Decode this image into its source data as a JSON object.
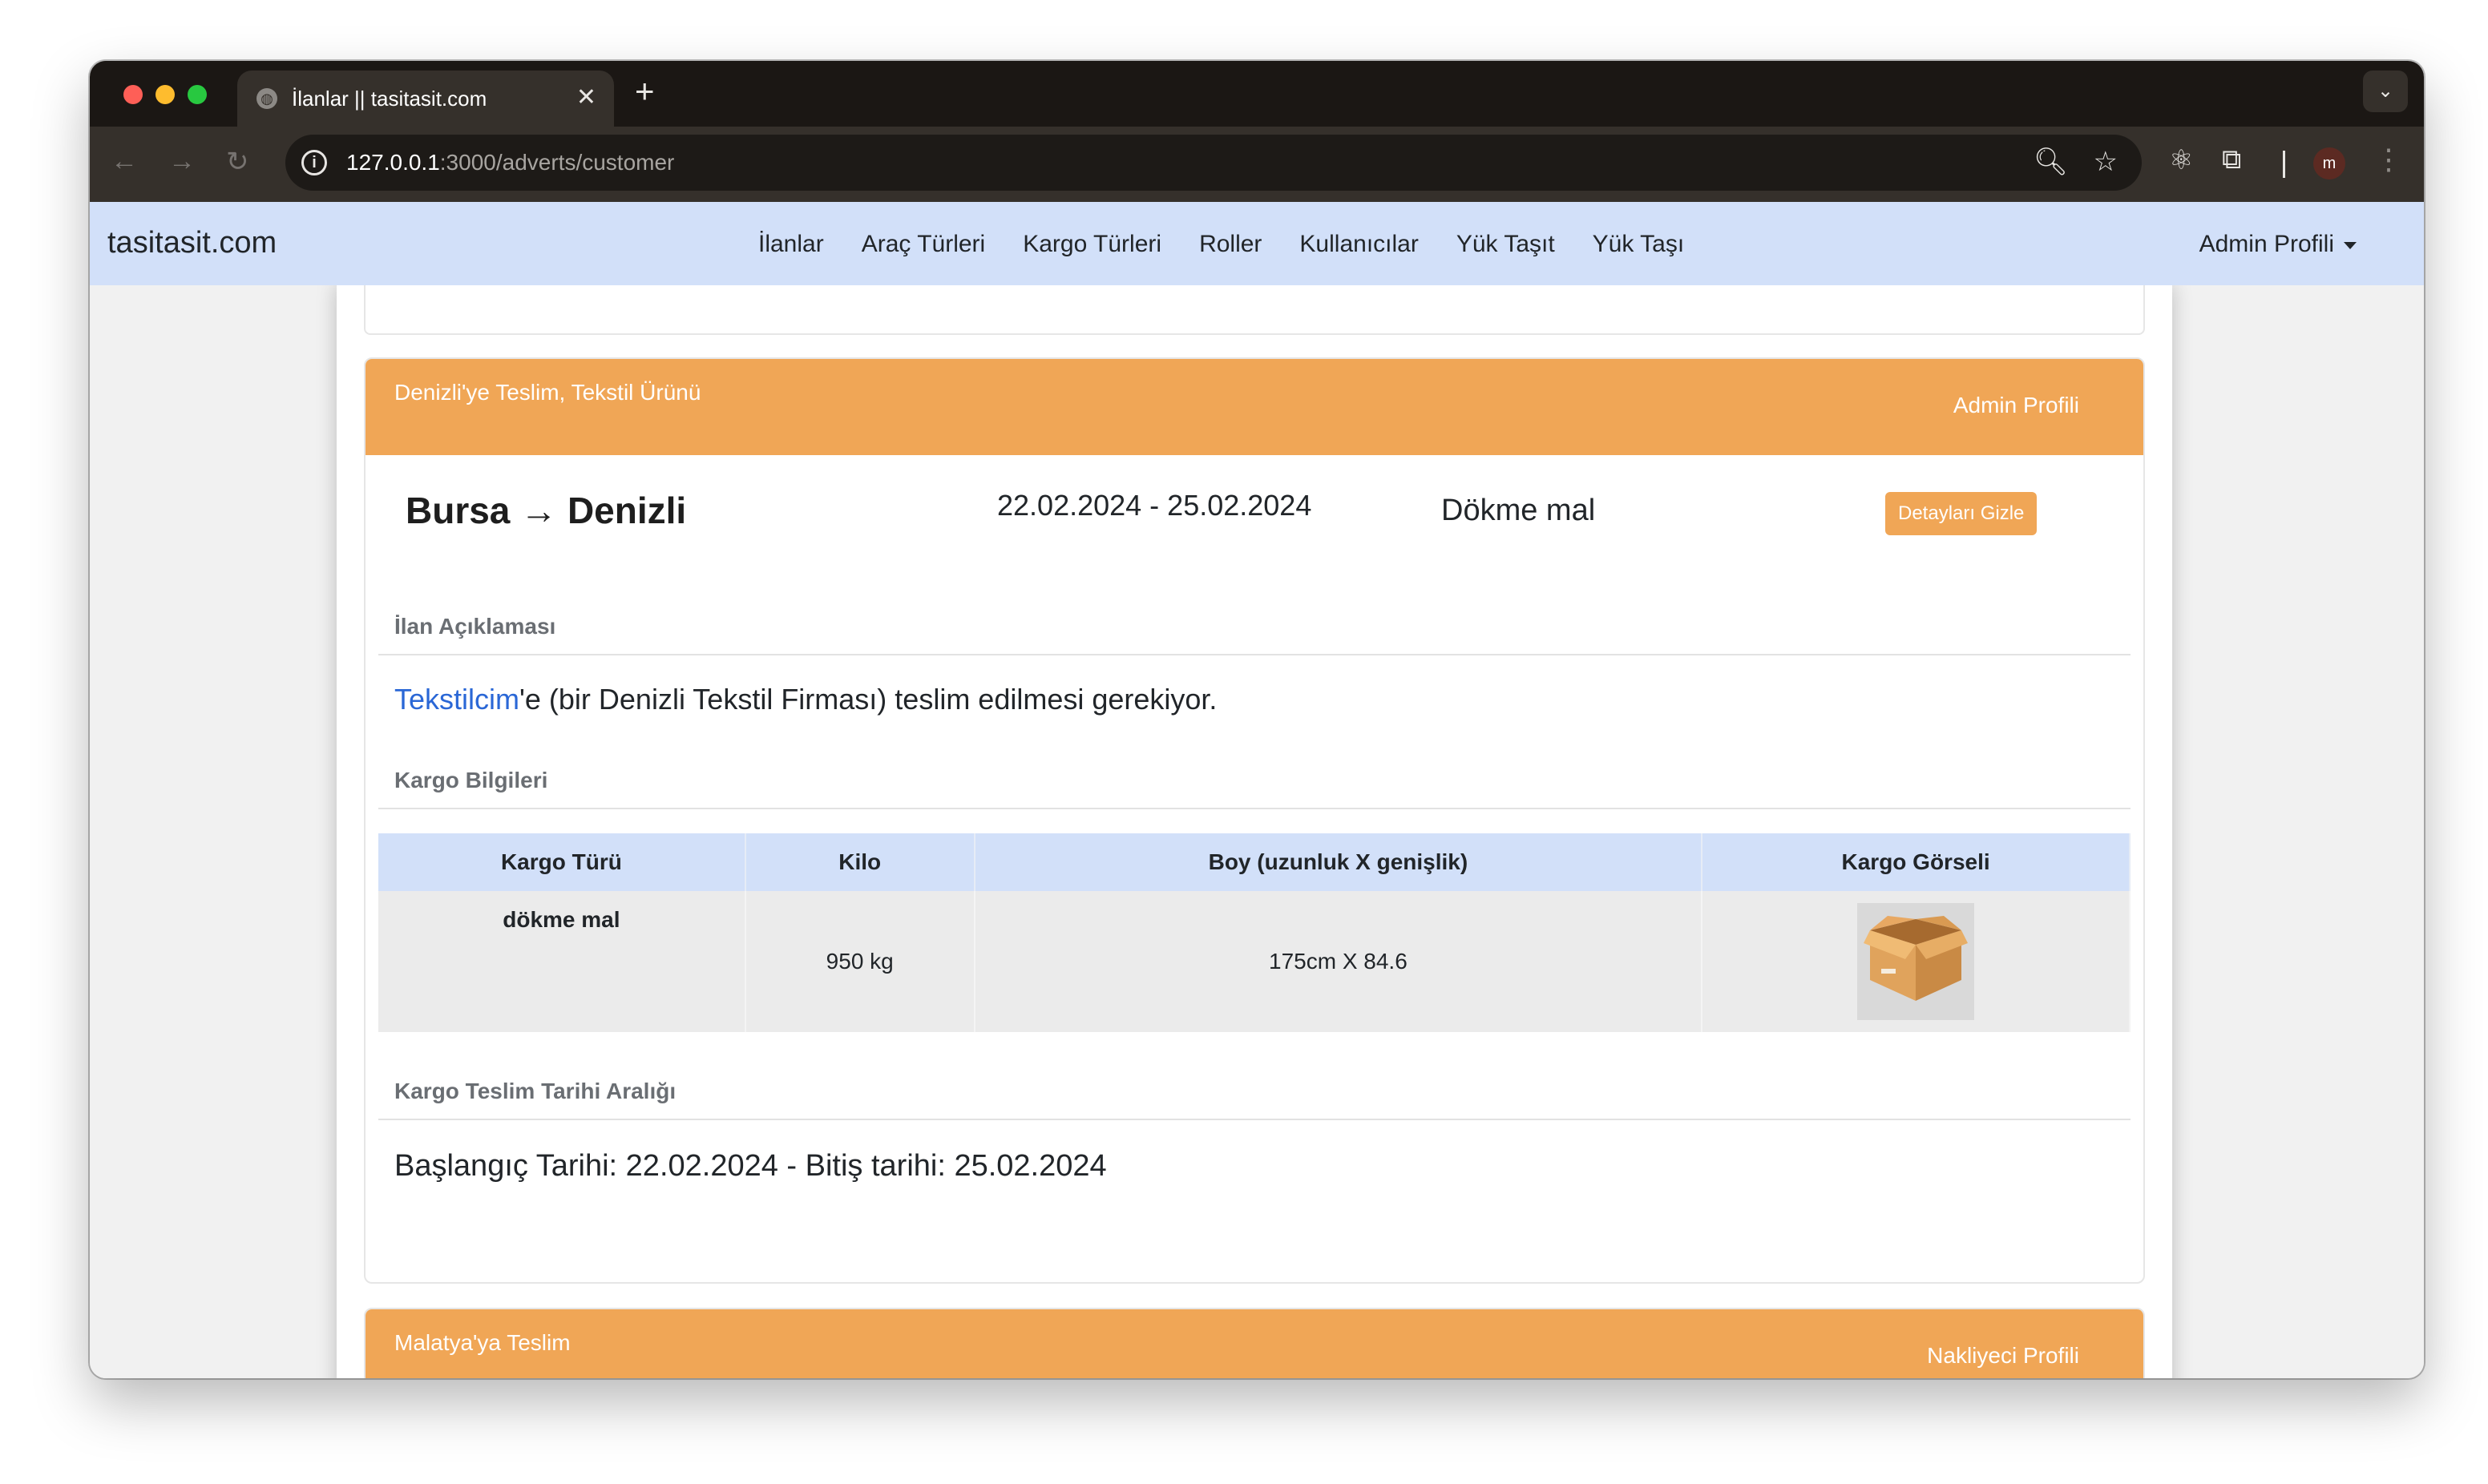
{
  "browser": {
    "tab_title": "İlanlar || tasitasit.com",
    "url_host": "127.0.0.1",
    "url_rest": ":3000/adverts/customer",
    "profile_initial": "m"
  },
  "navbar": {
    "brand": "tasitasit.com",
    "links": [
      "İlanlar",
      "Araç Türleri",
      "Kargo Türleri",
      "Roller",
      "Kullanıcılar",
      "Yük Taşıt",
      "Yük Taşı"
    ],
    "profile_menu": "Admin Profili"
  },
  "adverts": [
    {
      "title": "Denizli'ye Teslim, Tekstil Ürünü",
      "owner": "Admin Profili",
      "route": "Bursa → Denizli",
      "date_range": "22.02.2024 - 25.02.2024",
      "cargo_type": "Dökme mal",
      "details_button": "Detayları Gizle",
      "description_heading": "İlan Açıklaması",
      "description_link": "Tekstilcim",
      "description_rest": "'e (bir Denizli Tekstil Firması) teslim edilmesi gerekiyor.",
      "cargo_heading": "Kargo Bilgileri",
      "cargo_table": {
        "headers": [
          "Kargo Türü",
          "Kilo",
          "Boy (uzunluk X genişlik)",
          "Kargo Görseli"
        ],
        "row": {
          "kind": "dökme mal",
          "weight": "950 kg",
          "size": "175cm X 84.6",
          "image": "cardboard-box-icon"
        }
      },
      "range_heading": "Kargo Teslim Tarihi Aralığı",
      "range_text": "Başlangıç Tarihi: 22.02.2024 - Bitiş tarihi: 25.02.2024"
    },
    {
      "title": "Malatya'ya Teslim",
      "owner": "Nakliyeci Profili"
    }
  ],
  "colors": {
    "accent_orange": "#f0a656",
    "navbar_blue": "#d2e0f9",
    "link_blue": "#2a67d6"
  }
}
